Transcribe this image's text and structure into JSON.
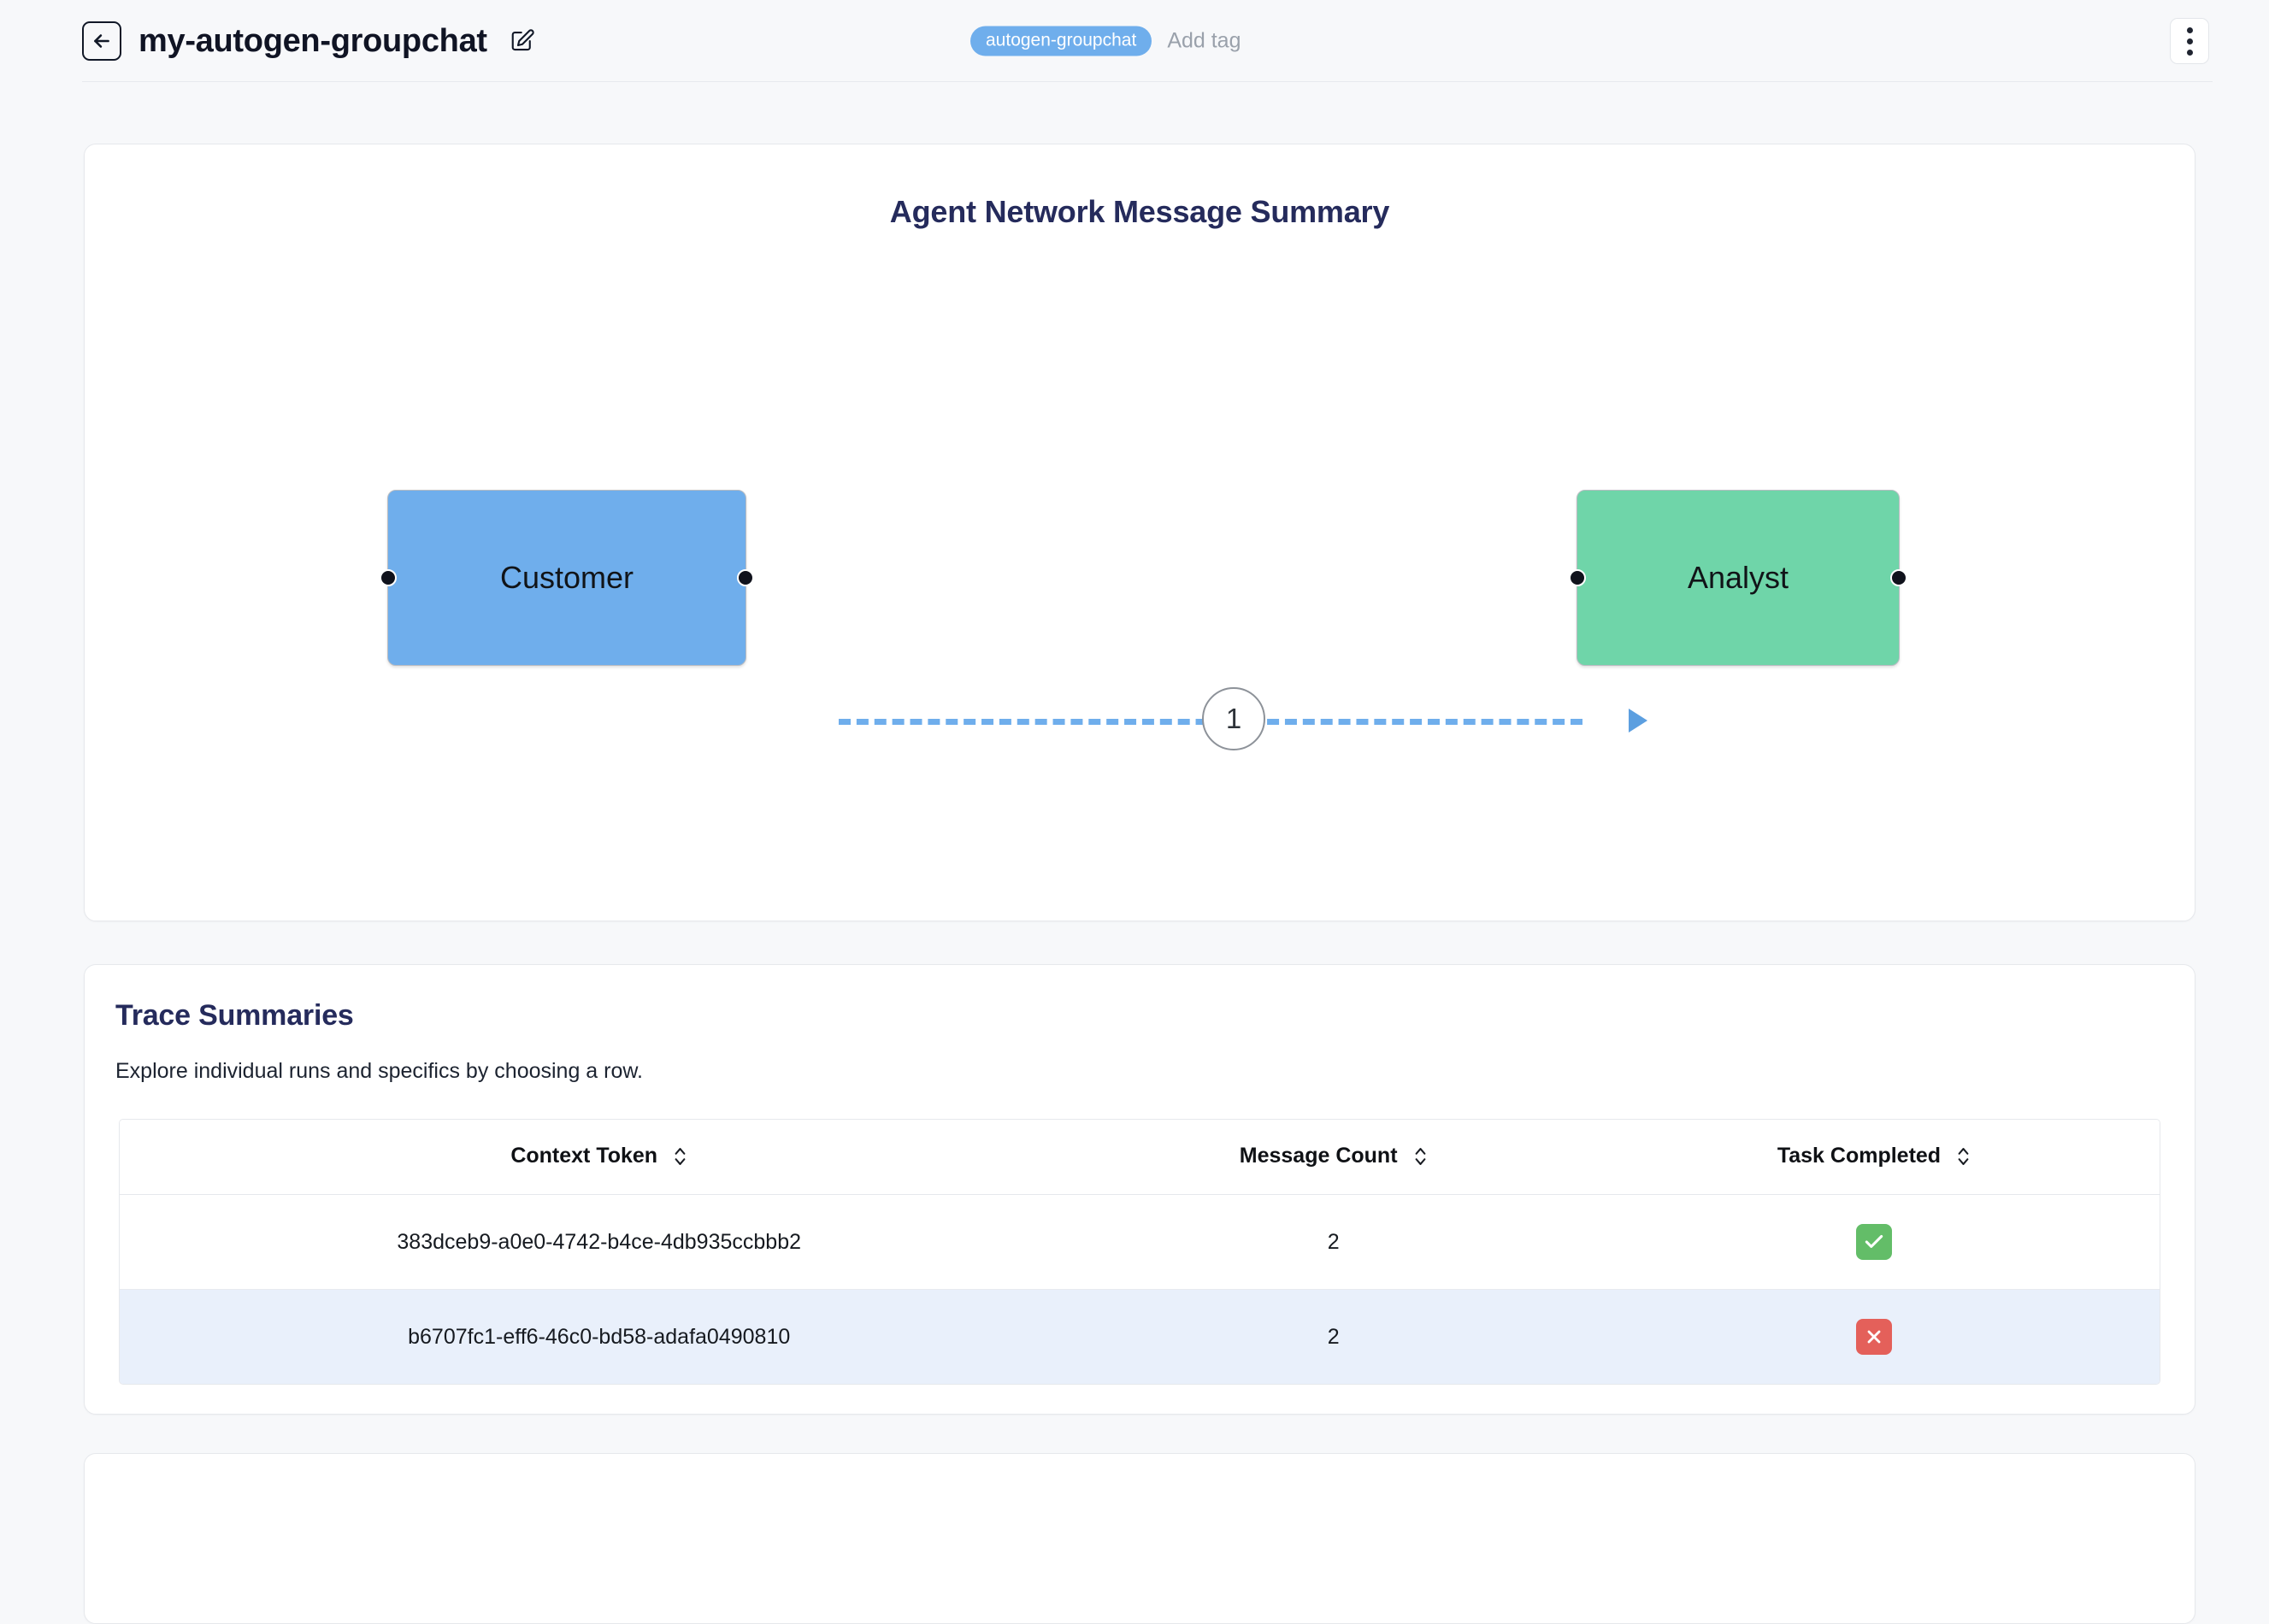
{
  "header": {
    "back_icon": "arrow-left-icon",
    "title": "my-autogen-groupchat",
    "edit_icon": "pencil-edit-icon",
    "tag": "autogen-groupchat",
    "add_tag_label": "Add tag",
    "menu_icon": "kebab-menu-icon"
  },
  "graph": {
    "title": "Agent Network Message Summary",
    "nodes": [
      {
        "id": "customer",
        "label": "Customer",
        "color": "#6FAEEC"
      },
      {
        "id": "analyst",
        "label": "Analyst",
        "color": "#6FD5A9"
      }
    ],
    "edges": [
      {
        "from": "Customer",
        "to": "Analyst",
        "label": "1",
        "color": "#6FAEEC",
        "style": "dashed",
        "arrow": true
      }
    ]
  },
  "trace": {
    "title": "Trace Summaries",
    "subtitle": "Explore individual runs and specifics by choosing a row.",
    "columns": [
      {
        "label": "Context Token",
        "sort_icon": "sort-chevrons-icon"
      },
      {
        "label": "Message Count",
        "sort_icon": "sort-chevrons-icon"
      },
      {
        "label": "Task Completed",
        "sort_icon": "sort-chevrons-icon"
      }
    ],
    "rows": [
      {
        "context_token": "383dceb9-a0e0-4742-b4ce-4db935ccbbb2",
        "message_count": "2",
        "task_completed": true,
        "status_icon": "check-icon",
        "status_color": "#63bd68"
      },
      {
        "context_token": "b6707fc1-eff6-46c0-bd58-adafa0490810",
        "message_count": "2",
        "task_completed": false,
        "status_icon": "close-x-icon",
        "status_color": "#e4605a"
      }
    ]
  },
  "chart_data": {
    "type": "diagram",
    "title": "Agent Network Message Summary",
    "nodes": [
      "Customer",
      "Analyst"
    ],
    "edges": [
      {
        "source": "Customer",
        "target": "Analyst",
        "value": 1
      }
    ]
  }
}
